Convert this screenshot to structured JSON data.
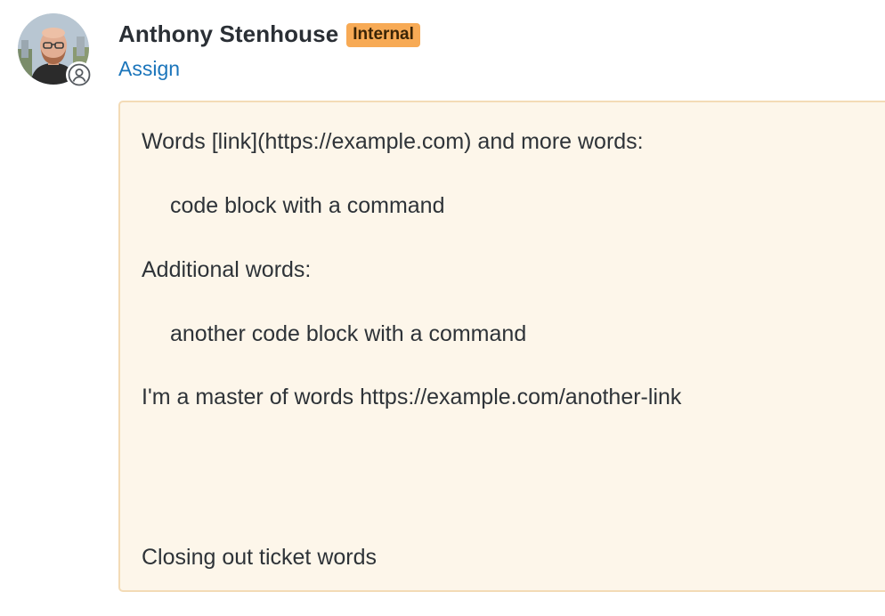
{
  "author": {
    "name": "Anthony Stenhouse",
    "badge": "Internal",
    "assign_label": "Assign"
  },
  "note": {
    "lines": [
      "Words [link](https://example.com) and more words:",
      "code block with a command",
      "Additional words:",
      "another code block with a command",
      "I'm a master of words https://example.com/another-link",
      "Closing out ticket words"
    ]
  },
  "colors": {
    "badge_bg": "#f7aa55",
    "link": "#1b75bb",
    "note_bg": "#fdf6ea",
    "note_border": "#f3dbb6"
  },
  "icons": {
    "avatar": "user-avatar-photo",
    "status": "person-outline-icon"
  }
}
